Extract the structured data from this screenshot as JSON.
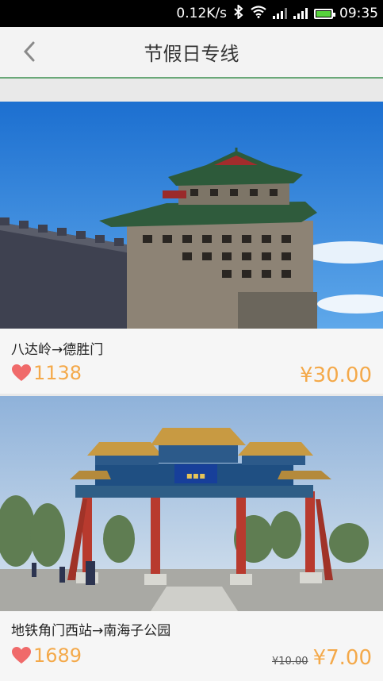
{
  "status_bar": {
    "speed": "0.12K/s",
    "time": "09:35",
    "icons": [
      "bluetooth-icon",
      "wifi-icon",
      "signal-icon",
      "signal-icon",
      "battery-icon"
    ]
  },
  "header": {
    "title": "节假日专线",
    "back_icon": "chevron-left-icon"
  },
  "routes": [
    {
      "route": "八达岭→德胜门",
      "likes": "1138",
      "price": "¥30.00",
      "old_price": ""
    },
    {
      "route": "地铁角门西站→南海子公园",
      "likes": "1689",
      "price": "¥7.00",
      "old_price": "¥10.00"
    }
  ],
  "colors": {
    "accent": "#f4a94a",
    "heart": "#f06a6a",
    "divider": "#6aa878"
  }
}
